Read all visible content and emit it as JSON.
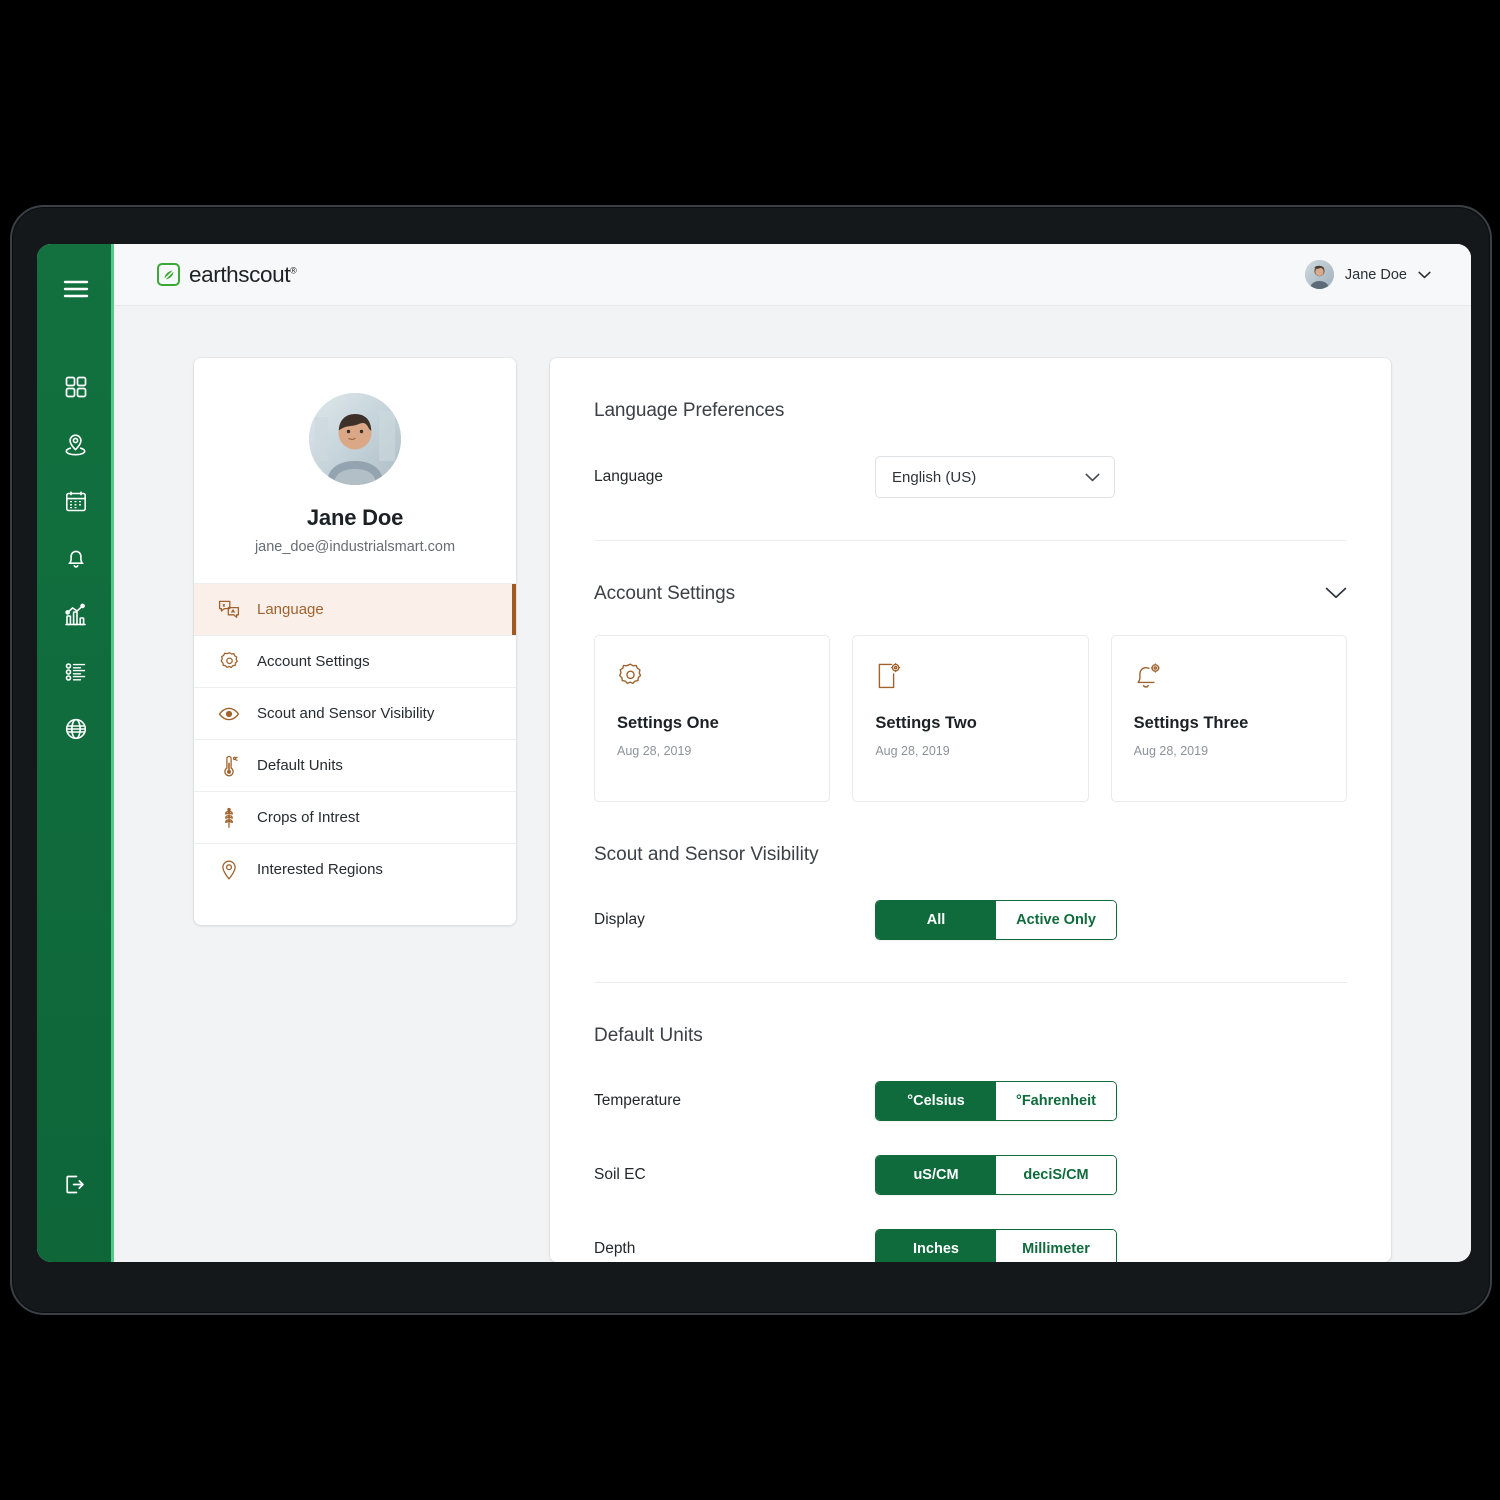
{
  "app": {
    "logo_text": "earthscout",
    "logo_tm": "®",
    "brand_green": "#0f6b3c",
    "accent_brown": "#9e5a23"
  },
  "header": {
    "user_name": "Jane Doe",
    "chevron_icon": "chevron-down-icon",
    "avatar_icon": "avatar"
  },
  "sidebar": {
    "items": [
      {
        "icon": "hamburger-menu-icon",
        "name": "menu-toggle"
      },
      {
        "icon": "dashboard-grid-icon",
        "name": "dashboard"
      },
      {
        "icon": "location-pin-icon",
        "name": "locations"
      },
      {
        "icon": "calendar-icon",
        "name": "calendar"
      },
      {
        "icon": "bell-icon",
        "name": "alerts"
      },
      {
        "icon": "analytics-chart-icon",
        "name": "analytics"
      },
      {
        "icon": "list-icon",
        "name": "reports"
      },
      {
        "icon": "globe-icon",
        "name": "global"
      }
    ],
    "logout": {
      "icon": "logout-icon",
      "name": "logout"
    }
  },
  "profile": {
    "name": "Jane Doe",
    "email": "jane_doe@industrialsmart.com",
    "menu": [
      {
        "label": "Language",
        "icon": "translate-icon",
        "active": true
      },
      {
        "label": "Account Settings",
        "icon": "gear-icon",
        "active": false
      },
      {
        "label": "Scout and Sensor Visibility",
        "icon": "eye-icon",
        "active": false
      },
      {
        "label": "Default Units",
        "icon": "thermometer-icon",
        "active": false
      },
      {
        "label": "Crops of Intrest",
        "icon": "wheat-icon",
        "active": false
      },
      {
        "label": "Interested Regions",
        "icon": "map-pin-icon",
        "active": false
      }
    ]
  },
  "settings": {
    "language_section": {
      "heading": "Language Preferences",
      "row_label": "Language",
      "selected": "English (US)",
      "options": [
        "English (US)"
      ]
    },
    "account_section": {
      "heading": "Account Settings",
      "collapse_icon": "chevron-down-icon",
      "cards": [
        {
          "title": "Settings One",
          "date": "Aug 28, 2019",
          "icon": "gear-icon"
        },
        {
          "title": "Settings Two",
          "date": "Aug 28, 2019",
          "icon": "document-gear-icon"
        },
        {
          "title": "Settings Three",
          "date": "Aug 28, 2019",
          "icon": "bell-gear-icon"
        }
      ]
    },
    "visibility_section": {
      "heading": "Scout and Sensor Visibility",
      "row_label": "Display",
      "option_a": "All",
      "option_b": "Active Only",
      "selected": "All"
    },
    "units_section": {
      "heading": "Default Units",
      "rows": [
        {
          "label": "Temperature",
          "option_a": "°Celsius",
          "option_b": "°Fahrenheit",
          "selected": "°Celsius"
        },
        {
          "label": "Soil EC",
          "option_a": "uS/CM",
          "option_b": "deciS/CM",
          "selected": "uS/CM"
        },
        {
          "label": "Depth",
          "option_a": "Inches",
          "option_b": "Millimeter",
          "selected": "Inches"
        }
      ]
    }
  }
}
